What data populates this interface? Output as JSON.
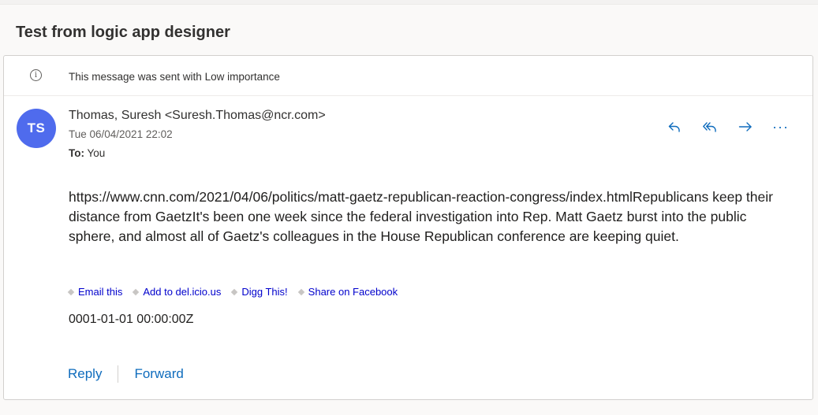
{
  "subject": "Test from logic app designer",
  "info_bar": {
    "icon": "info-icon",
    "text": "This message was sent with Low importance"
  },
  "sender": {
    "initials": "TS",
    "avatar_color": "#4f6bed",
    "name_line": "Thomas, Suresh <Suresh.Thomas@ncr.com>",
    "date": "Tue 06/04/2021 22:02",
    "to_label": "To:",
    "to_value": "You"
  },
  "actions": [
    {
      "name": "reply-icon"
    },
    {
      "name": "reply-all-icon"
    },
    {
      "name": "forward-icon"
    },
    {
      "name": "more-options-icon",
      "label": "···"
    }
  ],
  "body": {
    "text": "https://www.cnn.com/2021/04/06/politics/matt-gaetz-republican-reaction-congress/index.htmlRepublicans keep their distance from GaetzIt's been one week since the federal investigation into Rep. Matt Gaetz burst into the public sphere, and almost all of Gaetz's colleagues in the House Republican conference are keeping quiet.",
    "share_links": [
      "Email this",
      "Add to del.icio.us",
      "Digg This!",
      "Share on Facebook"
    ],
    "timestamp": "0001-01-01 00:00:00Z"
  },
  "footer": {
    "reply": "Reply",
    "forward": "Forward"
  },
  "colors": {
    "accent": "#0f6cbd",
    "link": "#0000cc"
  }
}
